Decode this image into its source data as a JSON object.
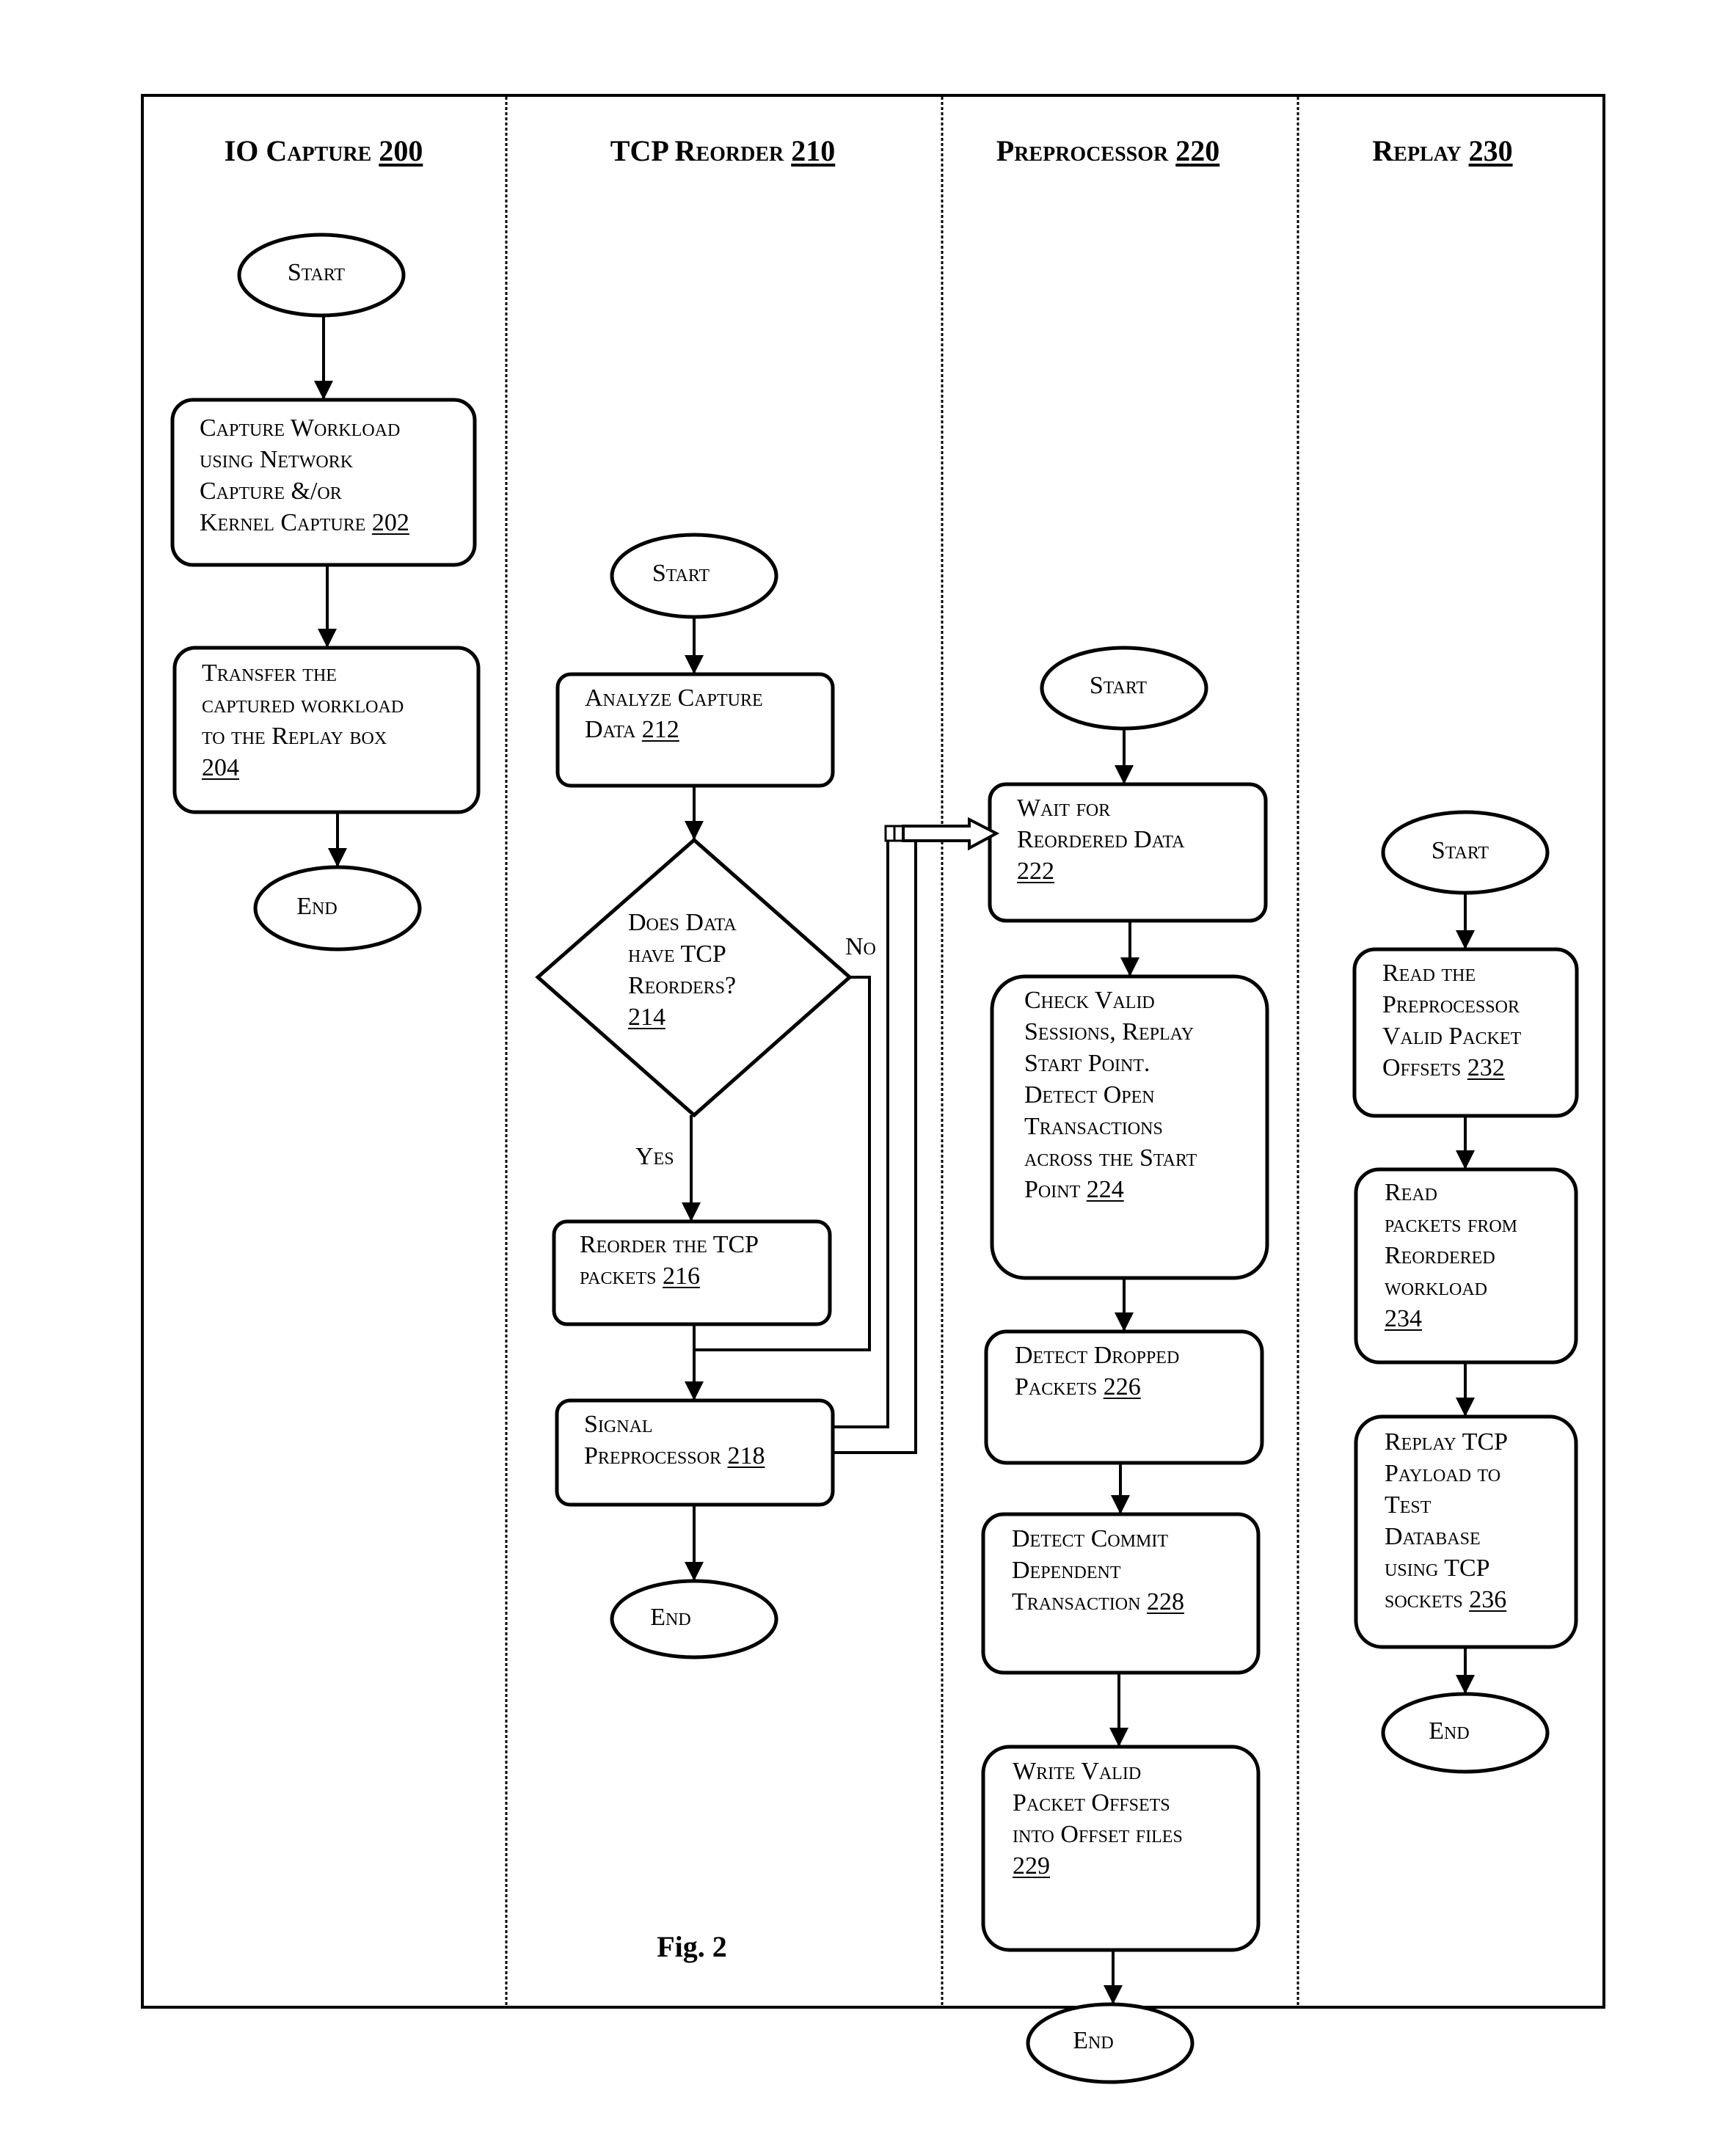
{
  "figure": {
    "caption": "Fig. 2",
    "line_color": "#000000",
    "background": "#ffffff"
  },
  "lanes": [
    {
      "id": "io-capture",
      "title": "IO Capture",
      "ref": "200"
    },
    {
      "id": "tcp-reorder",
      "title": "TCP Reorder",
      "ref": "210"
    },
    {
      "id": "preprocessor",
      "title": "Preprocessor",
      "ref": "220"
    },
    {
      "id": "replay",
      "title": "Replay",
      "ref": "230"
    }
  ],
  "terminals": {
    "io_start": "Start",
    "io_end": "End",
    "tcp_start": "Start",
    "tcp_end": "End",
    "pre_start": "Start",
    "pre_end": "End",
    "rep_start": "Start",
    "rep_end": "End"
  },
  "steps": {
    "s202": {
      "text": "Capture Workload\nusing Network\nCapture &/or\nKernel Capture ",
      "ref": "202"
    },
    "s204": {
      "text": "Transfer the\ncaptured workload\nto the Replay box\n",
      "ref": "204"
    },
    "s212": {
      "text": "Analyze Capture\nData ",
      "ref": "212"
    },
    "s214": {
      "text": "Does Data\nhave TCP\nReorders?\n",
      "ref": "214"
    },
    "s216": {
      "text": "Reorder the TCP\npackets ",
      "ref": "216"
    },
    "s218": {
      "text": "Signal\nPreprocessor ",
      "ref": "218"
    },
    "s222": {
      "text": "Wait for\nReordered Data\n",
      "ref": "222"
    },
    "s224": {
      "text": "Check Valid\nSessions, Replay\nStart Point.\nDetect Open\nTransactions\nacross the Start\nPoint ",
      "ref": "224"
    },
    "s226": {
      "text": "Detect Dropped\nPackets ",
      "ref": "226"
    },
    "s228": {
      "text": "Detect Commit\nDependent\nTransaction ",
      "ref": "228"
    },
    "s229": {
      "text": "Write Valid\nPacket Offsets\ninto Offset files\n",
      "ref": "229"
    },
    "s232": {
      "text": "Read the\nPreprocessor\nValid Packet\nOffsets ",
      "ref": "232"
    },
    "s234": {
      "text": "Read\npackets from\nReordered\nworkload\n",
      "ref": "234"
    },
    "s236": {
      "text": "Replay TCP\nPayload to\nTest\nDatabase\nusing TCP\nsockets ",
      "ref": "236"
    }
  },
  "edge_labels": {
    "no": "No",
    "yes": "Yes"
  }
}
